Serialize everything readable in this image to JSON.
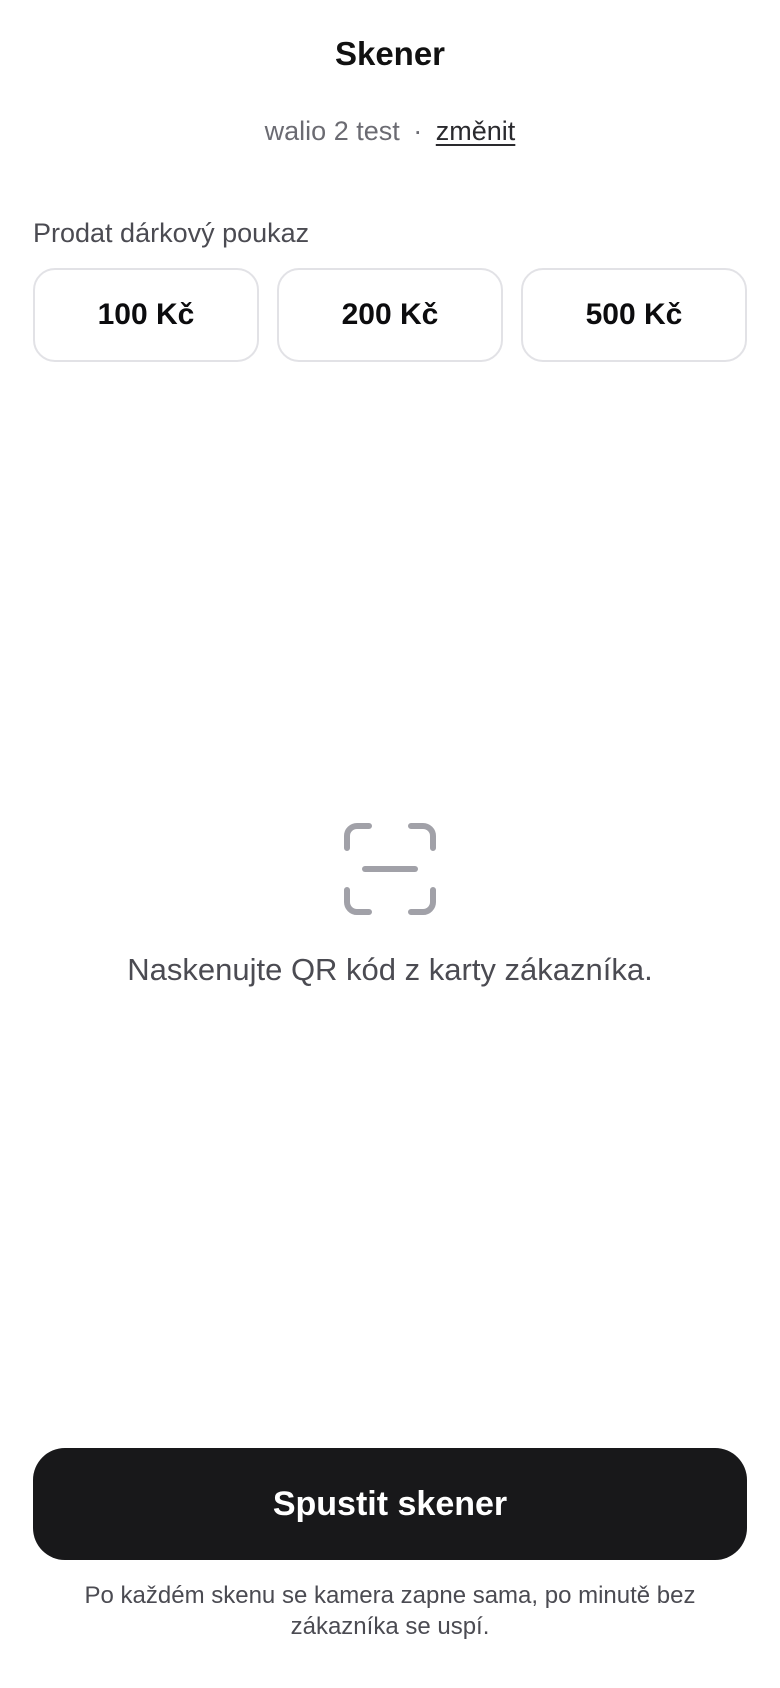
{
  "header": {
    "title": "Skener"
  },
  "store": {
    "name": "walio 2 test",
    "separator": "·",
    "change_label": "změnit"
  },
  "voucher": {
    "section_label": "Prodat dárkový poukaz",
    "options": [
      {
        "label": "100 Kč"
      },
      {
        "label": "200 Kč"
      },
      {
        "label": "500 Kč"
      }
    ]
  },
  "scanner": {
    "icon": "qr-scan-frame-icon",
    "icon_color": "#a1a1a8",
    "hint": "Naskenujte QR kód z karty zákazníka."
  },
  "actions": {
    "start_label": "Spustit skener",
    "start_bg": "#18181a",
    "footnote": "Po každém skenu se kamera zapne sama, po minutě bez zákazníka se uspí."
  }
}
